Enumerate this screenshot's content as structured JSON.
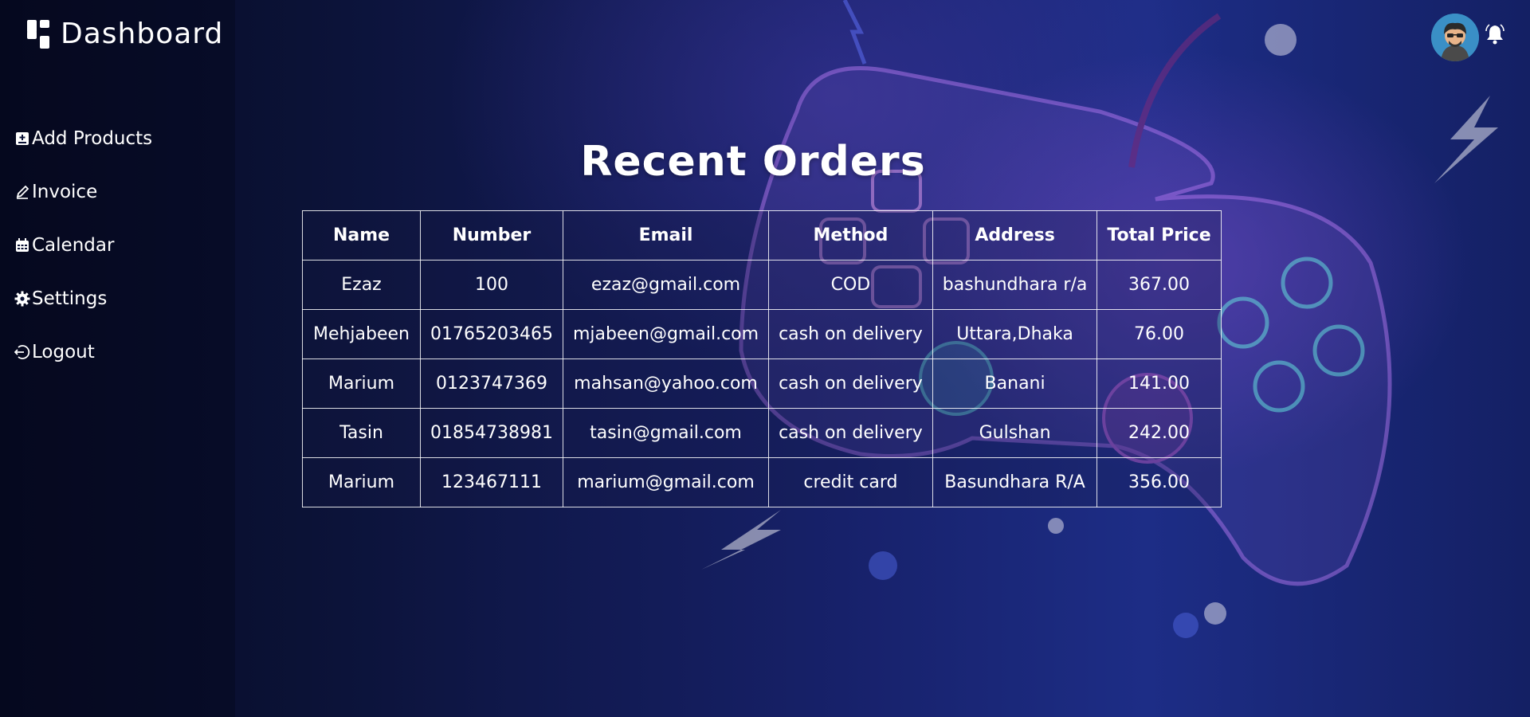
{
  "sidebar": {
    "brand": {
      "icon": "dashboard-grid-icon",
      "title": "Dashboard"
    },
    "items": [
      {
        "label": "Add Products",
        "icon": "add-box-icon"
      },
      {
        "label": "Invoice",
        "icon": "pencil-icon"
      },
      {
        "label": "Calendar",
        "icon": "calendar-icon"
      },
      {
        "label": "Settings",
        "icon": "gear-icon"
      },
      {
        "label": "Logout",
        "icon": "logout-icon"
      }
    ]
  },
  "header": {
    "avatar_icon": "user-avatar",
    "bell_icon": "bell-icon"
  },
  "main": {
    "title": "Recent Orders",
    "table": {
      "headers": [
        "Name",
        "Number",
        "Email",
        "Method",
        "Address",
        "Total Price"
      ],
      "rows": [
        [
          "Ezaz",
          "100",
          "ezaz@gmail.com",
          "COD",
          "bashundhara r/a",
          "367.00"
        ],
        [
          "Mehjabeen",
          "01765203465",
          "mjabeen@gmail.com",
          "cash on delivery",
          "Uttara,Dhaka",
          "76.00"
        ],
        [
          "Marium",
          "0123747369",
          "mahsan@yahoo.com",
          "cash on delivery",
          "Banani",
          "141.00"
        ],
        [
          "Tasin",
          "01854738981",
          "tasin@gmail.com",
          "cash on delivery",
          "Gulshan",
          "242.00"
        ],
        [
          "Marium",
          "123467111",
          "marium@gmail.com",
          "credit card",
          "Basundhara R/A",
          "356.00"
        ]
      ]
    }
  },
  "colors": {
    "text": "#ffffff",
    "background": "#17216a",
    "avatar_bg": "#3a8fc6"
  }
}
